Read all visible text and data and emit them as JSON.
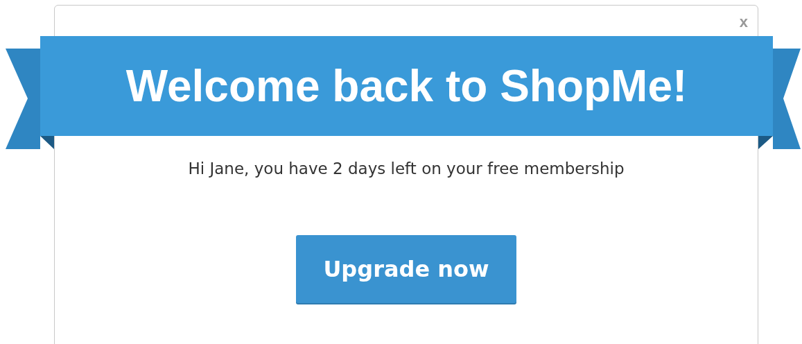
{
  "dialog": {
    "close": "x",
    "title": "Welcome back to ShopMe!",
    "message": "Hi Jane, you have 2 days left on your free membership",
    "button": "Upgrade now"
  }
}
